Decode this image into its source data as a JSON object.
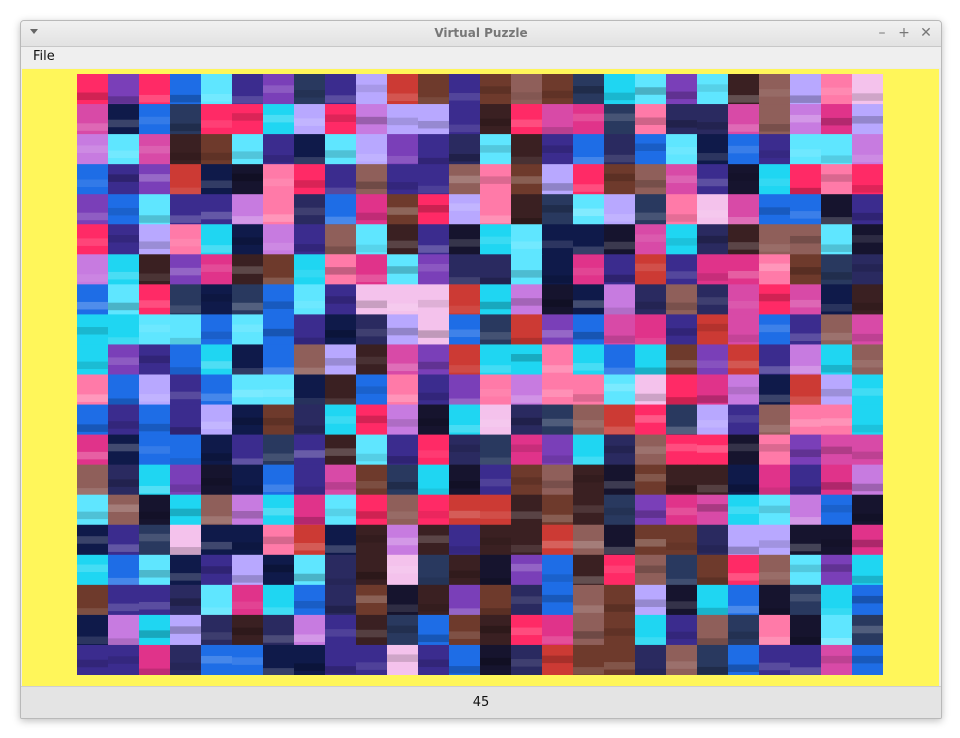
{
  "window": {
    "title": "Virtual Puzzle"
  },
  "menu": {
    "file_label": "File"
  },
  "status": {
    "value": "45"
  },
  "puzzle": {
    "columns": 26,
    "rows": 20
  },
  "colors": {
    "background": "#fff65a",
    "palette": [
      "#1fd6f2",
      "#1e6de6",
      "#3b2c8e",
      "#7a3fb8",
      "#c77be0",
      "#e0338a",
      "#ff2a66",
      "#cc3a34",
      "#6e3a2c",
      "#3a2022",
      "#16142e",
      "#0f1a4a",
      "#f4c2ec",
      "#5fe6ff",
      "#b8a8ff",
      "#2a2a60",
      "#8f5f5a",
      "#ff7aa8",
      "#d84aa7",
      "#29395f"
    ]
  }
}
